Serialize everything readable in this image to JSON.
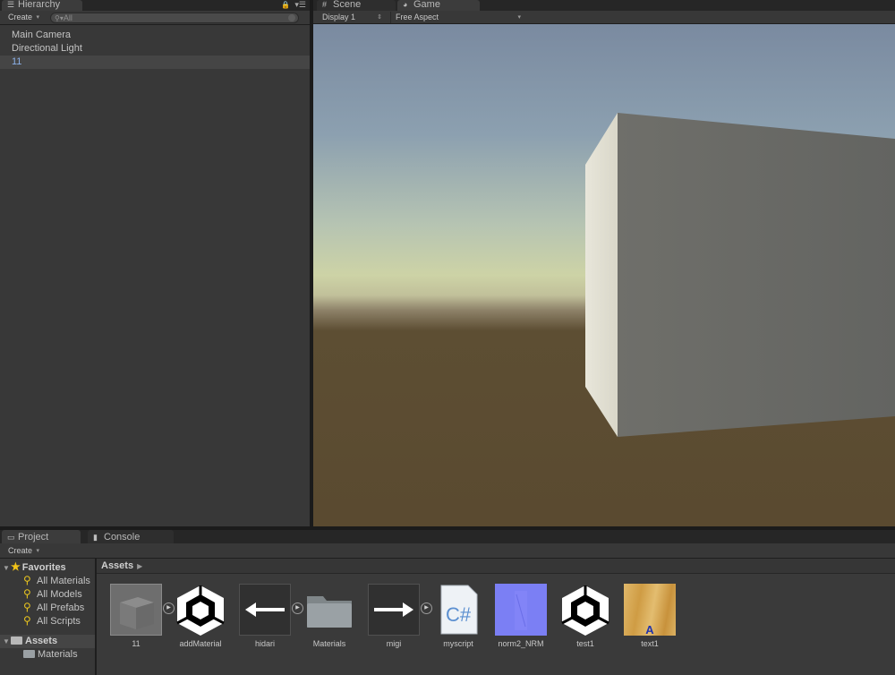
{
  "hierarchy": {
    "tab_label": "Hierarchy",
    "create_label": "Create",
    "search_placeholder": "All",
    "items": [
      {
        "label": "Main Camera"
      },
      {
        "label": "Directional Light"
      },
      {
        "label": "11",
        "selected": true
      }
    ]
  },
  "game_view": {
    "tabs": [
      {
        "label": "Scene",
        "active": false
      },
      {
        "label": "Game",
        "active": true
      }
    ],
    "display_label": "Display 1",
    "aspect_label": "Free Aspect"
  },
  "project": {
    "tabs": [
      {
        "label": "Project",
        "active": true
      },
      {
        "label": "Console",
        "active": false
      }
    ],
    "create_label": "Create",
    "favorites": {
      "label": "Favorites",
      "items": [
        "All Materials",
        "All Models",
        "All Prefabs",
        "All Scripts"
      ]
    },
    "assets_tree": {
      "label": "Assets",
      "children": [
        "Materials"
      ]
    },
    "breadcrumb": "Assets",
    "assets": [
      {
        "label": "11",
        "icon": "cube-model-icon"
      },
      {
        "label": "addMaterial",
        "icon": "unity-logo-icon"
      },
      {
        "label": "hidari",
        "icon": "arrow-left-icon"
      },
      {
        "label": "Materials",
        "icon": "folder-icon"
      },
      {
        "label": "migi",
        "icon": "arrow-right-icon"
      },
      {
        "label": "myscript",
        "icon": "csharp-script-icon"
      },
      {
        "label": "norm2_NRM",
        "icon": "normal-map-texture-icon"
      },
      {
        "label": "test1",
        "icon": "unity-logo-icon"
      },
      {
        "label": "text1",
        "icon": "wood-texture-icon"
      }
    ]
  },
  "colors": {
    "panel": "#383838",
    "selection_text": "#8bb0e8",
    "sky_top": "#7a8aa0",
    "horizon": "#cdd3a6",
    "ground": "#5a4a30",
    "cube_front": "#6b6b66",
    "cube_side": "#e4e2d6"
  }
}
